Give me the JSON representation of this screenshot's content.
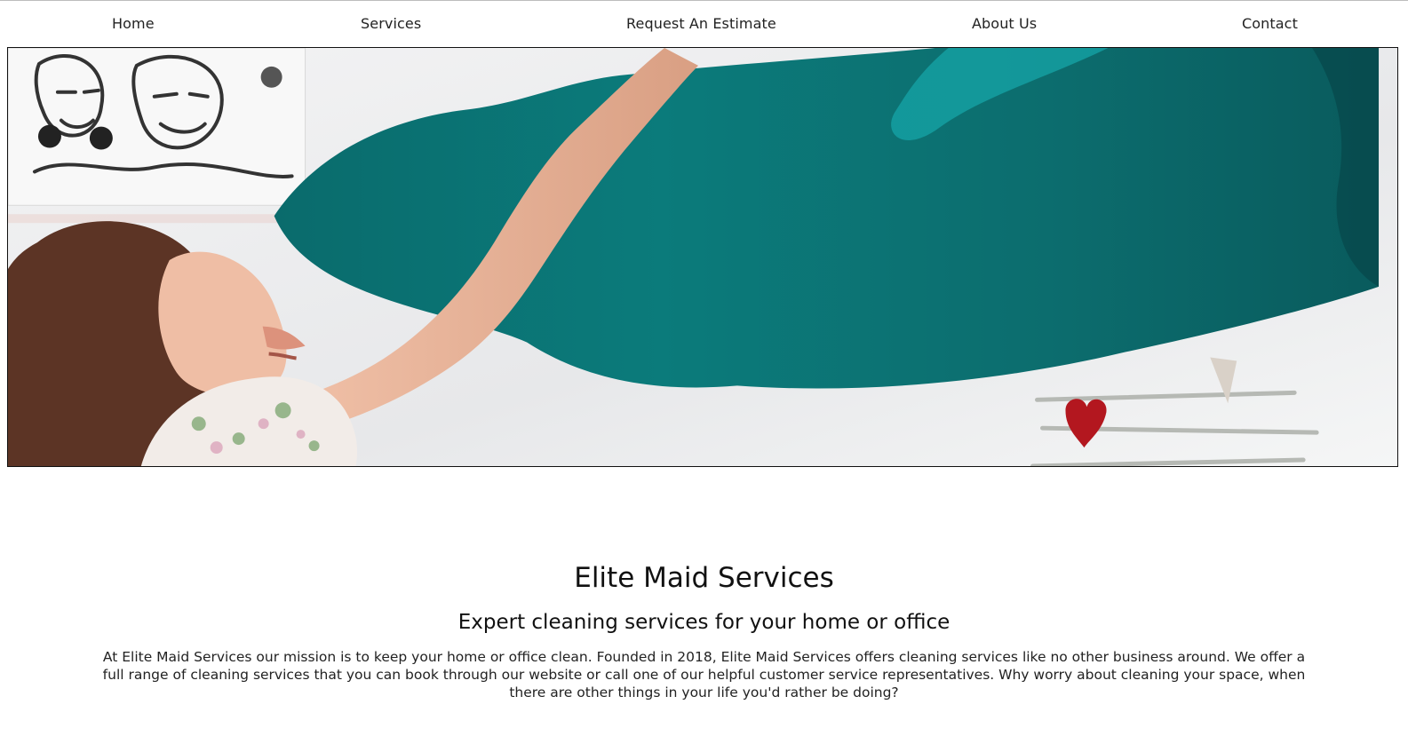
{
  "nav": {
    "items": [
      {
        "label": "Home"
      },
      {
        "label": "Services"
      },
      {
        "label": "Request An Estimate"
      },
      {
        "label": "About Us"
      },
      {
        "label": "Contact"
      }
    ]
  },
  "hero": {
    "image_subject": "woman-shaking-teal-sheet-photo"
  },
  "content": {
    "title": "Elite Maid Services",
    "subtitle": "Expert cleaning services for your home or office",
    "description": "At Elite Maid Services our mission is to keep your home or office clean. Founded in 2018, Elite Maid Services offers cleaning services like no other business around. We offer a full range of cleaning services that you can book through our website or call one of our helpful customer service representatives. Why worry about cleaning your space, when there are other things in your life you'd rather be doing?"
  },
  "colors": {
    "teal_sheet": "#0b6f70",
    "text": "#111111",
    "background": "#ffffff"
  }
}
